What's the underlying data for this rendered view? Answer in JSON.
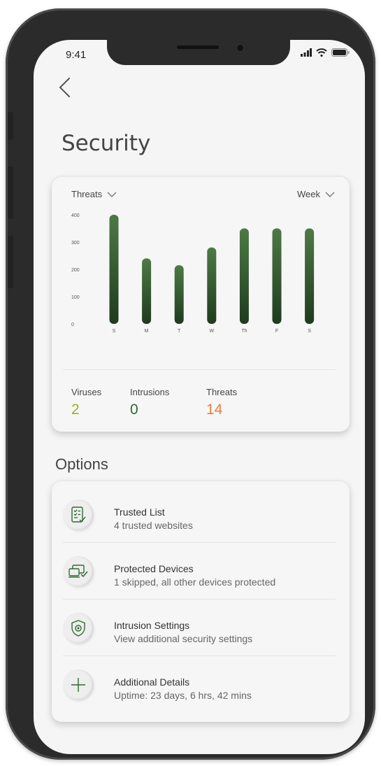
{
  "status_bar": {
    "time": "9:41"
  },
  "page": {
    "title": "Security"
  },
  "chart_card": {
    "metric_dropdown": "Threats",
    "period_dropdown": "Week"
  },
  "chart_data": {
    "type": "bar",
    "categories": [
      "S",
      "M",
      "T",
      "W",
      "Th",
      "F",
      "S"
    ],
    "values": [
      400,
      240,
      215,
      280,
      350,
      350,
      350
    ],
    "y_ticks": [
      "400",
      "300",
      "200",
      "100",
      "0"
    ],
    "ylim": [
      0,
      400
    ],
    "title": "",
    "xlabel": "",
    "ylabel": "",
    "grid": false,
    "bar_color": "#3d6238"
  },
  "stats": [
    {
      "label": "Viruses",
      "value": "2",
      "color": "#9bb21f"
    },
    {
      "label": "Intrusions",
      "value": "0",
      "color": "#2e6b2f"
    },
    {
      "label": "Threats",
      "value": "14",
      "color": "#ef7d3c"
    }
  ],
  "options": {
    "title": "Options",
    "items": [
      {
        "title": "Trusted List",
        "subtitle": "4 trusted websites",
        "icon": "checklist-icon"
      },
      {
        "title": "Protected Devices",
        "subtitle": "1 skipped, all other devices protected",
        "icon": "devices-icon"
      },
      {
        "title": "Intrusion Settings",
        "subtitle": "View additional security settings",
        "icon": "shield-gear-icon"
      },
      {
        "title": "Additional Details",
        "subtitle": "Uptime: 23 days, 6 hrs, 42 mins",
        "icon": "plus-icon"
      }
    ]
  },
  "colors": {
    "accent": "#2e6b2f"
  }
}
